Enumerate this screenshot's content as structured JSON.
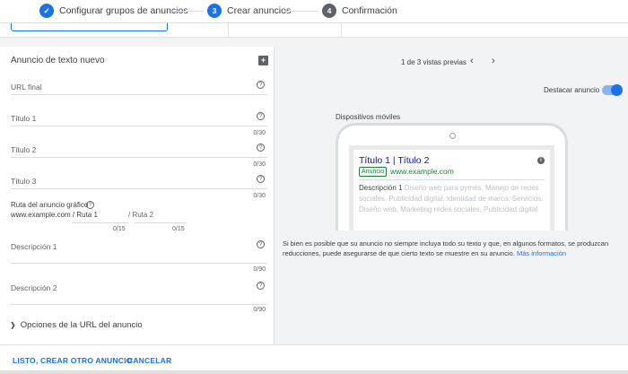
{
  "stepper": {
    "steps": [
      {
        "number": "✓",
        "label": "Configurar grupos de anuncios",
        "state": "done"
      },
      {
        "number": "3",
        "label": "Crear anuncios",
        "state": "active"
      },
      {
        "number": "4",
        "label": "Confirmación",
        "state": "pending"
      }
    ]
  },
  "form": {
    "title": "Anuncio de texto nuevo",
    "fields": {
      "url_final": {
        "label": "URL final"
      },
      "titulo1": {
        "label": "Título 1",
        "counter": "0/30"
      },
      "titulo2": {
        "label": "Título 2",
        "counter": "0/30"
      },
      "titulo3": {
        "label": "Título 3",
        "counter": "0/30"
      },
      "desc1": {
        "label": "Descripción 1",
        "counter": "0/90"
      },
      "desc2": {
        "label": "Descripción 2",
        "counter": "0/90"
      }
    },
    "ruta": {
      "label": "Ruta del anuncio gráfico",
      "url": "www.example.com / Ruta 1",
      "ruta2": "/ Ruta 2",
      "counter1": "0/15",
      "counter2": "0/15"
    },
    "url_options": "Opciones de la URL del anuncio"
  },
  "preview": {
    "count": "1 de 3 vistas previas",
    "highlight_label": "Destacar anuncio",
    "highlight_on": true,
    "mobile_label": "Dispositivos móviles",
    "ad": {
      "title": "Título 1 | Título 2",
      "badge": "Anuncio",
      "url": "www.example.com",
      "desc_strong": "Descripción 1",
      "desc_rest": " Diseño web para pymes. Manejo de redes sociales. Publicidad digital. Identidad de marca. Servicios: Diseño web, Marketing redes sociales, Publicidad digital"
    },
    "note": "Si bien es posible que su anuncio no siempre incluya todo su texto y que, en algunos formatos, se produzcan reducciones, puede asegurarse de que cierto texto se muestre en su anuncio.",
    "note_link": "Más información"
  },
  "actions": {
    "done_label": "LISTO, CREAR OTRO ANUNCIO",
    "cancel_label": "CANCELAR"
  },
  "colors": {
    "accent": "#1a73e8",
    "ad_green": "#188038",
    "ad_title": "#1a0dab"
  }
}
